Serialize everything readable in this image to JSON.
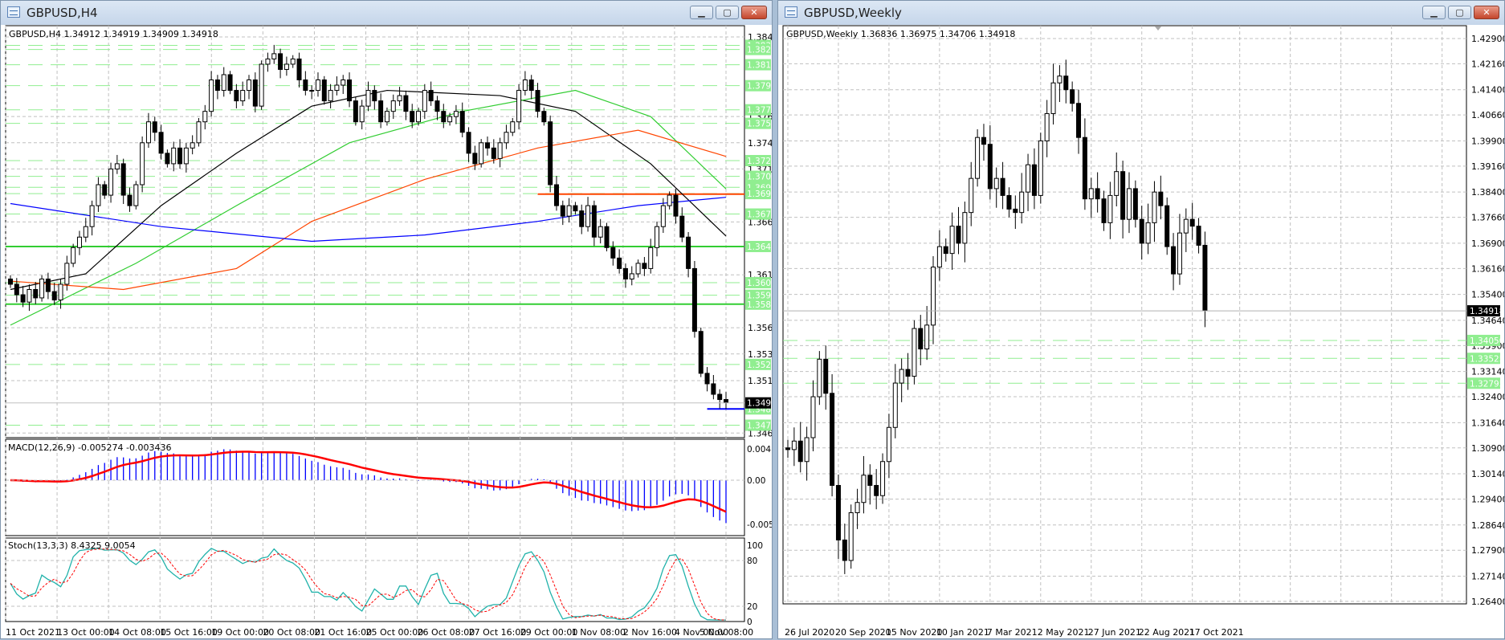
{
  "colors": {
    "bull": "#ffffff",
    "bear": "#000000",
    "level": "#90ee90",
    "solid_level": "#32cd32",
    "blue": "#0000ff",
    "orange": "#ff4500",
    "green": "#32cd32",
    "black": "#000000",
    "macd_hist": "#0000ff",
    "macd_signal": "#ff0000",
    "stoch_main": "#20b2aa",
    "stoch_signal": "#ff0000"
  },
  "left_window": {
    "title": "GBPUSD,H4",
    "header": "GBPUSD,H4  1.34912 1.34919 1.34909 1.34918",
    "buttons": {
      "minimize": "▁",
      "maximize": "▢",
      "close": "✕"
    },
    "price_range": {
      "top_price": 1.3841
    },
    "price_ticks": [
      "1.38410",
      "1.37650",
      "1.37400",
      "1.37150",
      "1.36645",
      "1.36140",
      "1.35635",
      "1.35385",
      "1.35130",
      "1.34630"
    ],
    "levels": [
      "1.38330",
      "1.38290",
      "1.38145",
      "1.37945",
      "1.37715",
      "1.37585",
      "1.37230",
      "1.37080",
      "1.36975",
      "1.36915",
      "1.36720",
      "1.36410",
      "1.36065",
      "1.35945",
      "1.35860",
      "1.35285",
      "1.34860",
      "1.34705"
    ],
    "solid_levels": [
      "1.36410",
      "1.35860"
    ],
    "orange_level": {
      "price": 1.3691,
      "from_bar": 84
    },
    "blue_level": {
      "price": 1.3486,
      "from_bar": 111
    },
    "current_price": "1.34918",
    "closes": [
      1.3605,
      1.3595,
      1.3588,
      1.36,
      1.3592,
      1.361,
      1.3598,
      1.359,
      1.3605,
      1.3625,
      1.364,
      1.365,
      1.366,
      1.368,
      1.37,
      1.369,
      1.3715,
      1.372,
      1.369,
      1.368,
      1.37,
      1.374,
      1.376,
      1.375,
      1.373,
      1.372,
      1.3735,
      1.372,
      1.3735,
      1.374,
      1.376,
      1.377,
      1.38,
      1.379,
      1.3805,
      1.379,
      1.378,
      1.379,
      1.38,
      1.3775,
      1.3815,
      1.382,
      1.3825,
      1.381,
      1.3815,
      1.382,
      1.38,
      1.379,
      1.379,
      1.38,
      1.378,
      1.379,
      1.3795,
      1.38,
      1.378,
      1.376,
      1.3775,
      1.379,
      1.378,
      1.376,
      1.377,
      1.378,
      1.3785,
      1.377,
      1.376,
      1.377,
      1.379,
      1.378,
      1.377,
      1.376,
      1.3765,
      1.377,
      1.375,
      1.373,
      1.372,
      1.374,
      1.3735,
      1.3725,
      1.374,
      1.375,
      1.376,
      1.379,
      1.38,
      1.379,
      1.377,
      1.376,
      1.37,
      1.368,
      1.367,
      1.368,
      1.3675,
      1.366,
      1.368,
      1.365,
      1.366,
      1.364,
      1.363,
      1.362,
      1.361,
      1.3615,
      1.3625,
      1.362,
      1.364,
      1.366,
      1.368,
      1.369,
      1.367,
      1.365,
      1.362,
      1.356,
      1.352,
      1.351,
      1.35,
      1.3495,
      1.3492
    ],
    "ma_lines": [
      {
        "name": "black",
        "points": [
          [
            0,
            1.36
          ],
          [
            12,
            1.3615
          ],
          [
            24,
            1.368
          ],
          [
            36,
            1.373
          ],
          [
            48,
            1.3775
          ],
          [
            60,
            1.379
          ],
          [
            78,
            1.3785
          ],
          [
            90,
            1.377
          ],
          [
            102,
            1.372
          ],
          [
            114,
            1.3651
          ]
        ]
      },
      {
        "name": "green",
        "points": [
          [
            0,
            1.3566
          ],
          [
            20,
            1.3625
          ],
          [
            36,
            1.368
          ],
          [
            54,
            1.374
          ],
          [
            72,
            1.377
          ],
          [
            90,
            1.379
          ],
          [
            102,
            1.3765
          ],
          [
            114,
            1.3696
          ]
        ]
      },
      {
        "name": "orange",
        "points": [
          [
            0,
            1.3608
          ],
          [
            18,
            1.36
          ],
          [
            36,
            1.362
          ],
          [
            48,
            1.3665
          ],
          [
            66,
            1.3705
          ],
          [
            84,
            1.3735
          ],
          [
            100,
            1.3752
          ],
          [
            114,
            1.3727
          ]
        ]
      },
      {
        "name": "blue",
        "points": [
          [
            0,
            1.3682
          ],
          [
            24,
            1.366
          ],
          [
            48,
            1.3646
          ],
          [
            66,
            1.3652
          ],
          [
            84,
            1.3665
          ],
          [
            100,
            1.368
          ],
          [
            114,
            1.3688
          ]
        ]
      }
    ],
    "macd": {
      "label": "MACD(12,26,9) -0.005274 -0.003436",
      "ticks": [
        "0.004145",
        "0.00",
        "-0.005723"
      ],
      "max": 0.004145,
      "min": -0.005723
    },
    "stoch": {
      "label": "Stoch(13,3,3) 8.4325 9.0054",
      "ticks": [
        "100",
        "80",
        "20",
        "0"
      ]
    },
    "time_labels": [
      "11 Oct 2021",
      "13 Oct 00:00",
      "14 Oct 08:00",
      "15 Oct 16:00",
      "19 Oct 00:00",
      "20 Oct 08:00",
      "21 Oct 16:00",
      "25 Oct 00:00",
      "26 Oct 08:00",
      "27 Oct 16:00",
      "29 Oct 00:00",
      "1 Nov 08:00",
      "2 Nov 16:00",
      "4 Nov 00:00",
      "5 Nov 08:00"
    ]
  },
  "right_window": {
    "title": "GBPUSD,Weekly",
    "header": "GBPUSD,Weekly  1.36836 1.36975 1.34706 1.34918",
    "buttons": {
      "minimize": "▁",
      "maximize": "▢",
      "close": "✕"
    },
    "price_range": {
      "top_price": 1.429
    },
    "price_ticks": [
      "1.42900",
      "1.42160",
      "1.41400",
      "1.40660",
      "1.39900",
      "1.39160",
      "1.38400",
      "1.37660",
      "1.36900",
      "1.36160",
      "1.35400",
      "1.34640",
      "1.33900",
      "1.33140",
      "1.32400",
      "1.31640",
      "1.30900",
      "1.30140",
      "1.29400",
      "1.28640",
      "1.27900",
      "1.27140",
      "1.26400"
    ],
    "levels": [
      "1.34050",
      "1.33525",
      "1.32795"
    ],
    "current_price": "1.34918",
    "closes": [
      1.3085,
      1.311,
      1.305,
      1.312,
      1.324,
      1.335,
      1.325,
      1.298,
      1.282,
      1.276,
      1.29,
      1.293,
      1.301,
      1.298,
      1.295,
      1.305,
      1.315,
      1.328,
      1.332,
      1.33,
      1.344,
      1.338,
      1.345,
      1.362,
      1.368,
      1.366,
      1.374,
      1.369,
      1.378,
      1.388,
      1.4,
      1.398,
      1.385,
      1.388,
      1.383,
      1.379,
      1.378,
      1.384,
      1.392,
      1.383,
      1.399,
      1.407,
      1.416,
      1.418,
      1.414,
      1.41,
      1.4,
      1.382,
      1.385,
      1.382,
      1.375,
      1.383,
      1.39,
      1.376,
      1.385,
      1.376,
      1.369,
      1.375,
      1.384,
      1.38,
      1.368,
      1.36,
      1.372,
      1.376,
      1.374,
      1.3684,
      1.3492
    ],
    "time_labels": [
      "26 Jul 2020",
      "20 Sep 2020",
      "15 Nov 2020",
      "10 Jan 2021",
      "7 Mar 2021",
      "2 May 2021",
      "27 Jun 2021",
      "22 Aug 2021",
      "17 Oct 2021"
    ]
  }
}
